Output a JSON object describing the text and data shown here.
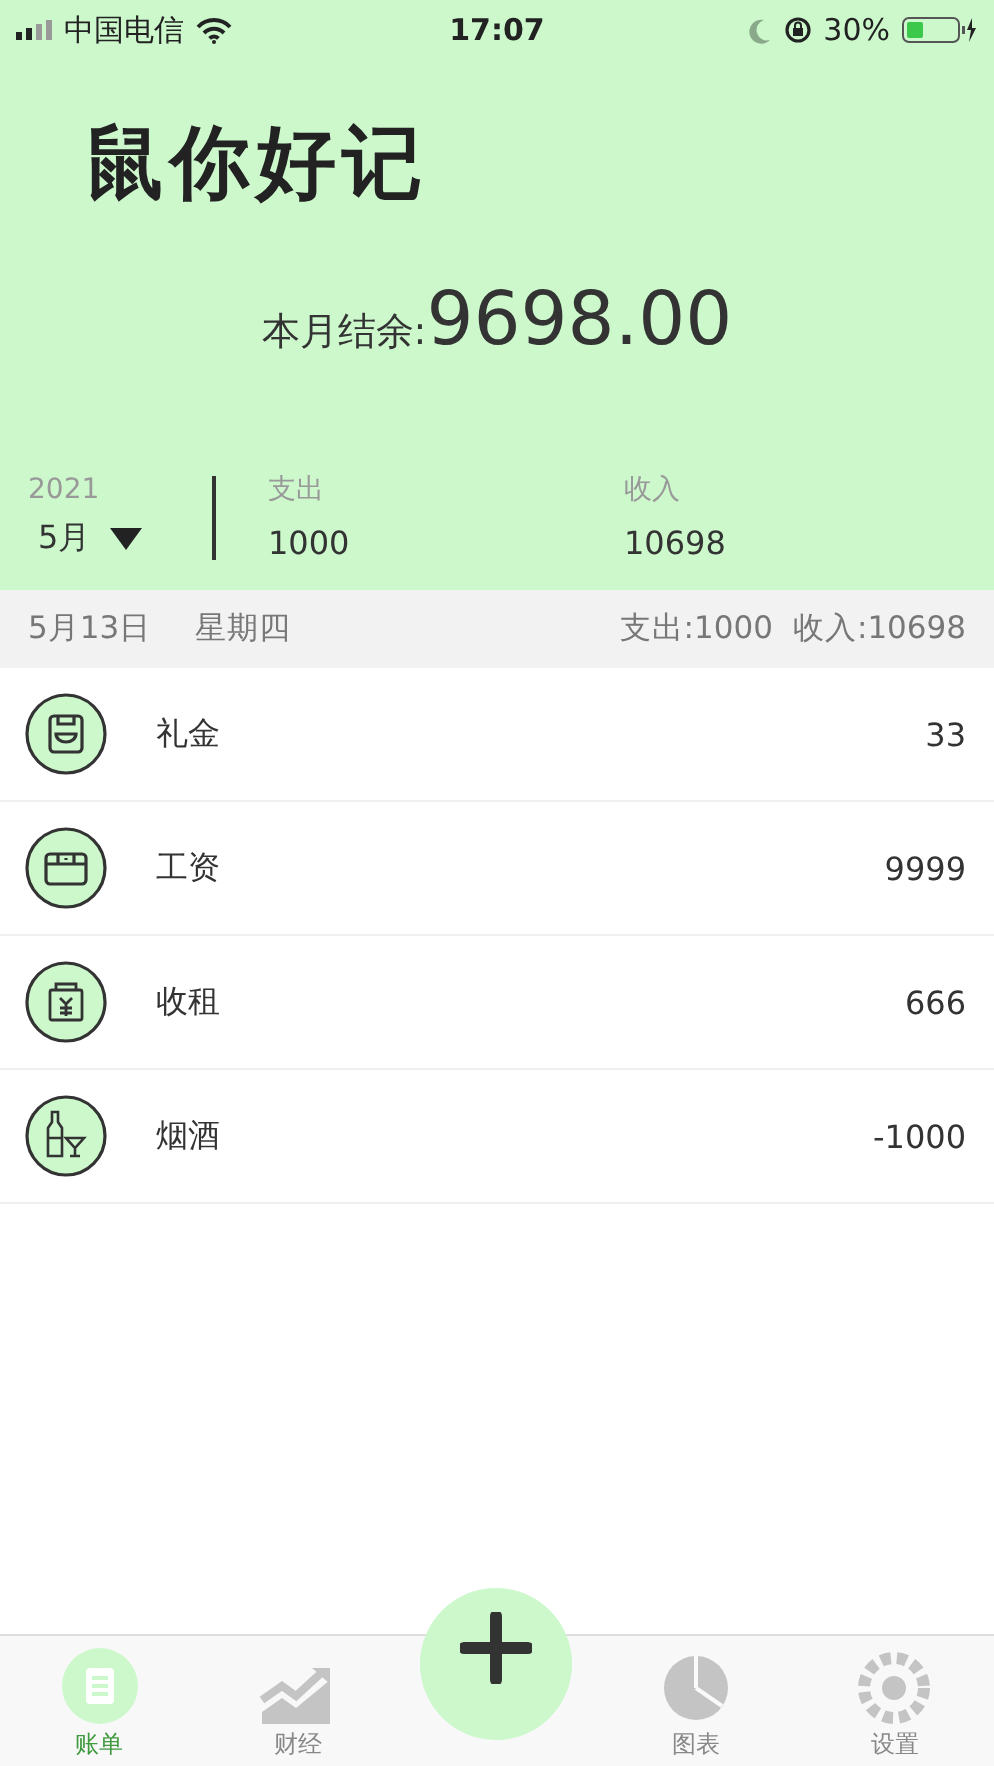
{
  "status_bar": {
    "carrier": "中国电信",
    "time": "17:07",
    "battery": "30%"
  },
  "title": "鼠你好记",
  "balance": {
    "label": "本月结余:",
    "value": "9698.00"
  },
  "period": {
    "year": "2021",
    "month": "5月"
  },
  "summary": [
    {
      "label": "支出",
      "value": "1000"
    },
    {
      "label": "收入",
      "value": "10698"
    }
  ],
  "day": {
    "date": "5月13日",
    "weekday": "星期四",
    "expense": "支出:1000",
    "income": "收入:10698"
  },
  "entries": [
    {
      "kind": "gift",
      "name": "礼金",
      "amount": "33"
    },
    {
      "kind": "salary",
      "name": "工资",
      "amount": "9999"
    },
    {
      "kind": "rent",
      "name": "收租",
      "amount": "666"
    },
    {
      "kind": "drinks",
      "name": "烟酒",
      "amount": "-1000"
    }
  ],
  "tabs": [
    {
      "kind": "bills",
      "label": "账单",
      "selected": true
    },
    {
      "kind": "finance",
      "label": "财经",
      "selected": false
    },
    {
      "kind": "charts",
      "label": "图表",
      "selected": false
    },
    {
      "kind": "settings",
      "label": "设置",
      "selected": false
    }
  ]
}
